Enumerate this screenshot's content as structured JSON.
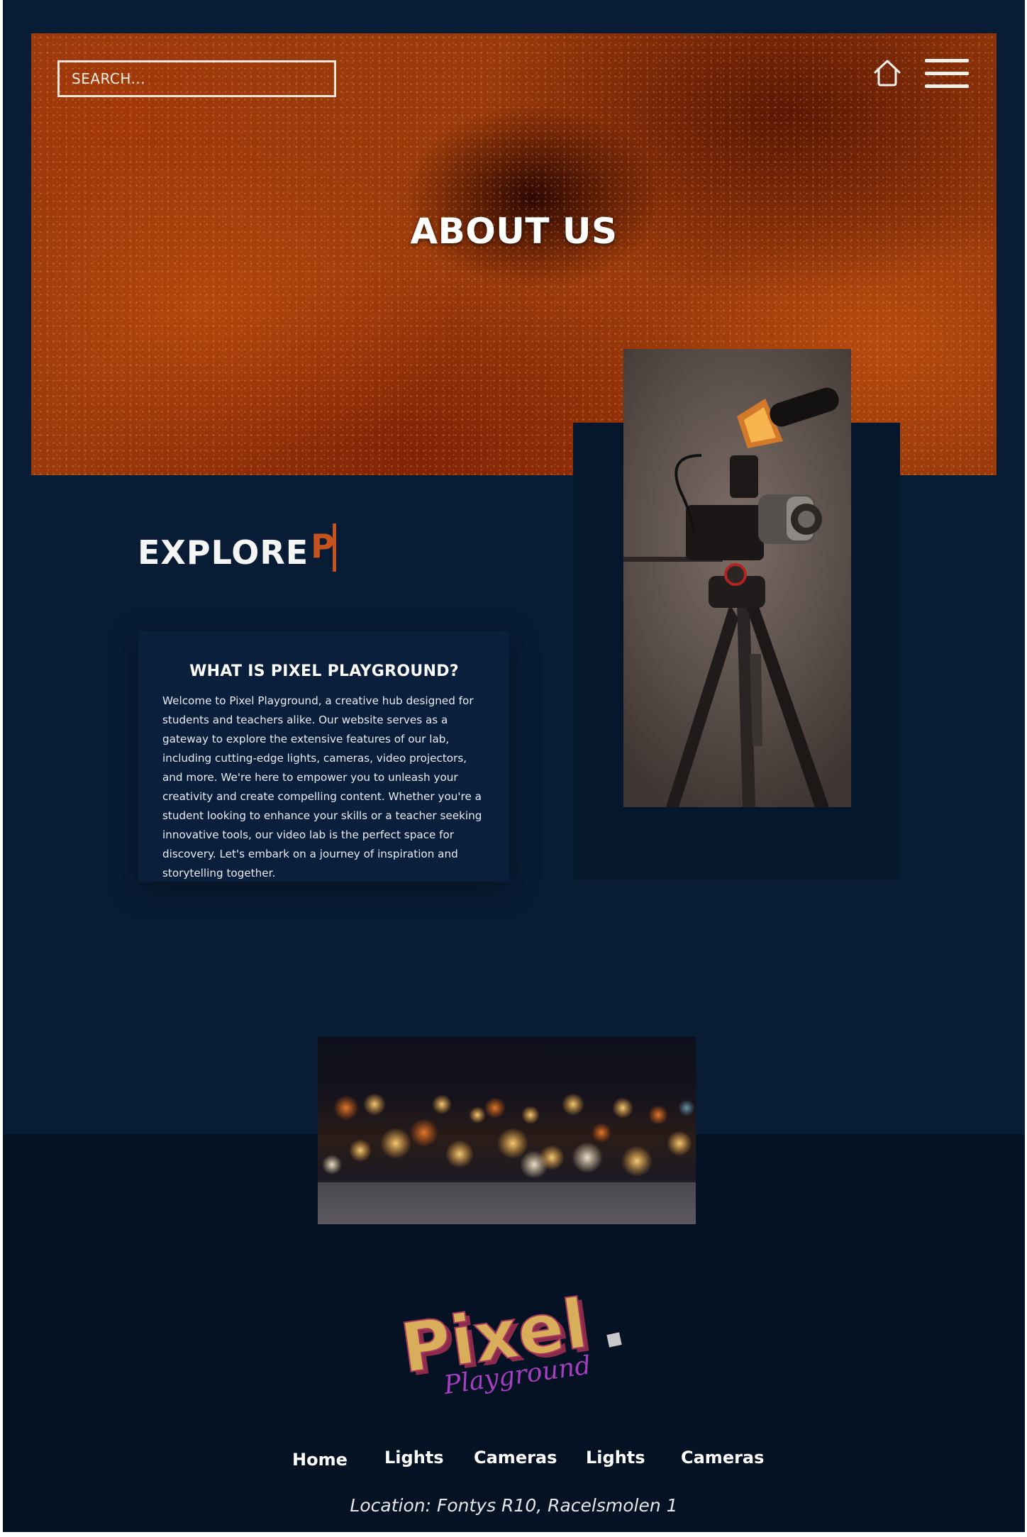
{
  "header": {
    "search_placeholder": "SEARCH...",
    "home_icon": "home-icon",
    "menu_icon": "hamburger-menu-icon"
  },
  "hero": {
    "title": "ABOUT US"
  },
  "explore": {
    "heading": "EXPLORE",
    "typed_text": "P"
  },
  "info_card": {
    "title": "WHAT IS PIXEL PLAYGROUND?",
    "body": "Welcome to Pixel Playground, a creative hub designed for students and teachers alike. Our website serves as a gateway to explore the extensive features of our lab, including cutting-edge lights, cameras, video projectors, and more. We're here to empower you to unleash your creativity and create compelling content. Whether you're a student looking to enhance your skills or a teacher seeking innovative tools, our video lab is the perfect space for discovery. Let's embark on a journey of inspiration and storytelling together."
  },
  "logo": {
    "word": "Pixel",
    "script": "Playground"
  },
  "footer": {
    "nav": [
      "Home",
      "Lights",
      "Cameras",
      "Lights",
      "Cameras"
    ],
    "location": "Location: Fontys R10, Racelsmolen 1"
  },
  "colors": {
    "page_bg": "#081c35",
    "footer_bg": "#051223",
    "accent_orange": "#c4531f",
    "card_bg": "#0a1f3b"
  }
}
